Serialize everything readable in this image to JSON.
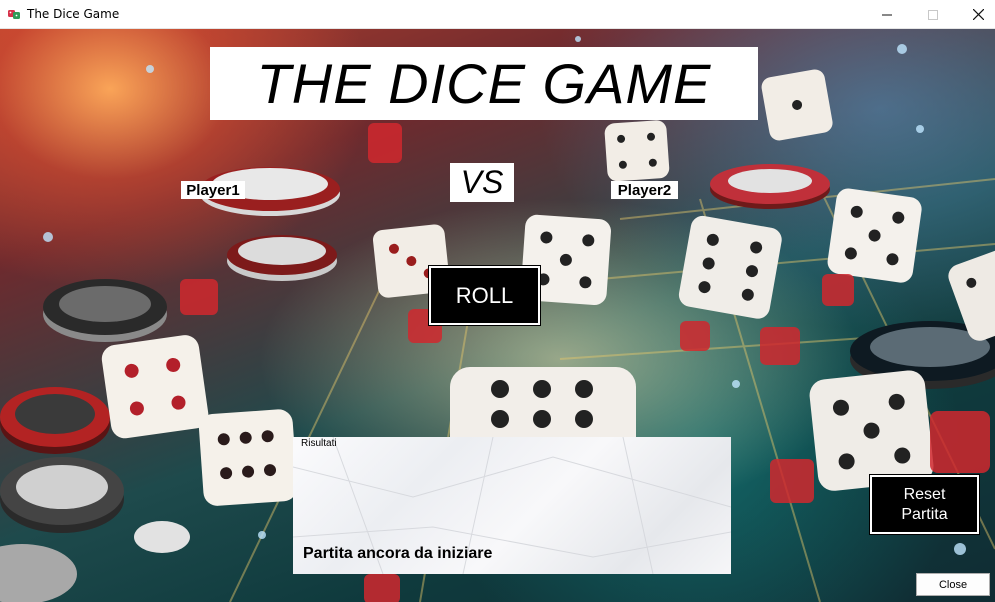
{
  "window": {
    "title": "The Dice Game",
    "app_icon": "dice-icon",
    "controls": {
      "minimize": "minimize-icon",
      "maximize": "maximize-icon",
      "close": "close-icon"
    }
  },
  "game": {
    "heading": "THE DICE GAME",
    "vs_label": "VS",
    "player1": "Player1",
    "player2": "Player2",
    "roll_button": "ROLL",
    "reset_button": [
      "Reset",
      "Partita"
    ]
  },
  "results": {
    "label": "Risultati",
    "status": "Partita ancora da iniziare"
  },
  "footer": {
    "close_button": "Close"
  },
  "colors": {
    "button_bg": "#000000",
    "button_text": "#ffffff",
    "felt": "#1e4a4c",
    "glow": "#b3402f"
  }
}
